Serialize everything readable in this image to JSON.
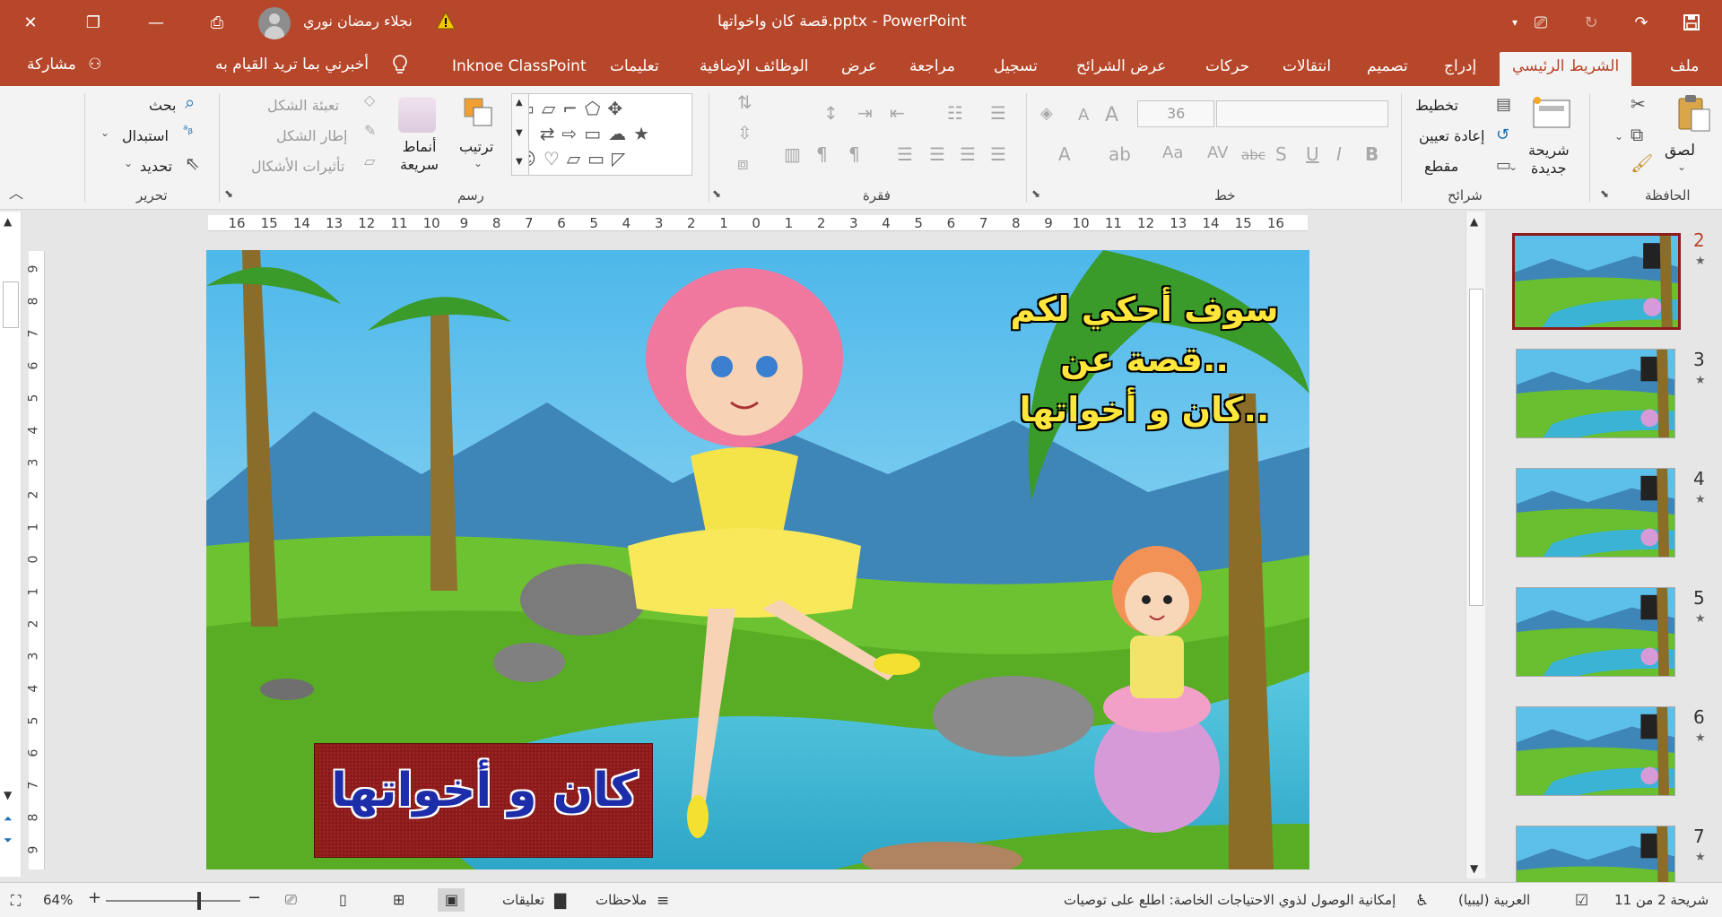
{
  "titlebar": {
    "document_title": "قصة كان واخواتها.pptx  -  PowerPoint",
    "user_name": "نجلاء رمضان نوري",
    "controls": [
      "close",
      "restore",
      "minimize",
      "display-options"
    ],
    "quick_access": [
      "save",
      "redo",
      "repeat",
      "present-from-start",
      "customize"
    ]
  },
  "tabs": [
    {
      "id": "file",
      "label": "ملف"
    },
    {
      "id": "home",
      "label": "الشريط الرئيسي",
      "active": true
    },
    {
      "id": "insert",
      "label": "إدراج"
    },
    {
      "id": "design",
      "label": "تصميم"
    },
    {
      "id": "transitions",
      "label": "انتقالات"
    },
    {
      "id": "animations",
      "label": "حركات"
    },
    {
      "id": "slideshow",
      "label": "عرض الشرائح"
    },
    {
      "id": "record",
      "label": "تسجيل"
    },
    {
      "id": "review",
      "label": "مراجعة"
    },
    {
      "id": "view",
      "label": "عرض"
    },
    {
      "id": "addins",
      "label": "الوظائف الإضافية"
    },
    {
      "id": "help",
      "label": "تعليمات"
    },
    {
      "id": "classpoint",
      "label": "Inknoe ClassPoint"
    }
  ],
  "tell_me": "أخبرني بما تريد القيام به",
  "share": "مشاركة",
  "ribbon": {
    "clipboard": {
      "group": "الحافظة",
      "paste": "لصق"
    },
    "slides": {
      "group": "شرائح",
      "new_slide": "شريحة\nجديدة",
      "layout": "تخطيط",
      "reset": "إعادة تعيين",
      "section": "مقطع"
    },
    "font": {
      "group": "خط",
      "size": "36"
    },
    "paragraph": {
      "group": "فقرة"
    },
    "drawing": {
      "group": "رسم",
      "arrange": "ترتيب",
      "quick_styles": "أنماط\nسريعة",
      "shape_fill": "تعبئة الشكل",
      "shape_outline": "إطار الشكل",
      "shape_effects": "تأثيرات الأشكال"
    },
    "editing": {
      "group": "تحرير",
      "find": "بحث",
      "replace": "استبدال",
      "select": "تحديد"
    }
  },
  "slide": {
    "story_lines": [
      "سوف أحكي لكم",
      "قصة عن..",
      "كان و أخواتها.."
    ],
    "title": "كان و أخواتها"
  },
  "ruler": {
    "h_labels": [
      "16",
      "15",
      "14",
      "13",
      "12",
      "11",
      "10",
      "9",
      "8",
      "7",
      "6",
      "5",
      "4",
      "3",
      "2",
      "1",
      "0",
      "1",
      "2",
      "3",
      "4",
      "5",
      "6",
      "7",
      "8",
      "9",
      "10",
      "11",
      "12",
      "13",
      "14",
      "15",
      "16"
    ],
    "v_labels": [
      "9",
      "8",
      "7",
      "6",
      "5",
      "4",
      "3",
      "2",
      "1",
      "0",
      "1",
      "2",
      "3",
      "4",
      "5",
      "6",
      "7",
      "8",
      "9"
    ]
  },
  "thumbnails": [
    {
      "num": "2",
      "selected": true
    },
    {
      "num": "3"
    },
    {
      "num": "4"
    },
    {
      "num": "5"
    },
    {
      "num": "6"
    },
    {
      "num": "7"
    }
  ],
  "statusbar": {
    "slide_info": "شريحة 2 من 11",
    "language": "العربية (ليبيا)",
    "accessibility": "إمكانية الوصول لذوي الاحتياجات الخاصة: اطلع على توصيات",
    "notes": "ملاحظات",
    "comments": "تعليقات",
    "zoom": "64%"
  },
  "colors": {
    "accent": "#b7472a",
    "ribbon_bg": "#f3f3f3",
    "workspace": "#e6e6e6"
  }
}
